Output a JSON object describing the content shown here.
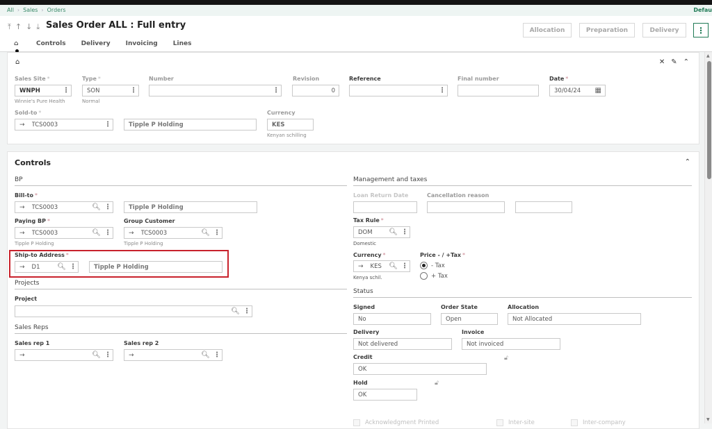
{
  "breadcrumb": [
    "All",
    "Sales",
    "Orders"
  ],
  "breadcrumb_right": "Defau",
  "header": {
    "nav_icons": [
      "first-record-icon",
      "previous-record-icon",
      "next-record-icon",
      "last-record-icon"
    ],
    "nav_glyphs": [
      "⤒",
      "↑",
      "↓",
      "⤓"
    ],
    "title": "Sales Order ALL : Full entry",
    "buttons": [
      "Allocation",
      "Preparation",
      "Delivery"
    ],
    "more_glyph": "⋮"
  },
  "tabs": [
    "Controls",
    "Delivery",
    "Invoicing",
    "Lines"
  ],
  "home_glyph": "⌂",
  "header_card": {
    "tools": {
      "pin": "✕",
      "edit": "✎",
      "collapse": "⌃"
    },
    "sales_site": {
      "label": "Sales Site",
      "value": "WNPH",
      "sub": "Winnie's Pure Health"
    },
    "type": {
      "label": "Type",
      "value": "SON",
      "sub": "Normal"
    },
    "number": {
      "label": "Number",
      "value": ""
    },
    "revision": {
      "label": "Revision",
      "value": "0"
    },
    "reference": {
      "label": "Reference",
      "value": ""
    },
    "final_number": {
      "label": "Final number",
      "value": ""
    },
    "date": {
      "label": "Date",
      "value": "30/04/24"
    },
    "sold_to": {
      "label": "Sold-to",
      "value": "TCS0003",
      "name": "Tipple P Holding"
    },
    "currency": {
      "label": "Currency",
      "value": "KES",
      "sub": "Kenyan schilling"
    }
  },
  "controls": {
    "title": "Controls",
    "bp_group": "BP",
    "bill_to": {
      "label": "Bill-to",
      "value": "TCS0003",
      "name": "Tipple P Holding"
    },
    "paying_bp": {
      "label": "Paying BP",
      "value": "TCS0003",
      "sub": "Tipple P Holding"
    },
    "group_customer": {
      "label": "Group Customer",
      "value": "TCS0003",
      "sub": "Tipple P Holding"
    },
    "ship_to": {
      "label": "Ship-to Address",
      "value": "D1",
      "name": "Tipple P Holding"
    },
    "projects_group": "Projects",
    "project": {
      "label": "Project",
      "value": ""
    },
    "sales_reps_group": "Sales Reps",
    "sales_rep1": {
      "label": "Sales rep 1",
      "value": ""
    },
    "sales_rep2": {
      "label": "Sales rep 2",
      "value": ""
    },
    "mgmt_group": "Management and taxes",
    "loan_return_date": {
      "label": "Loan Return Date",
      "value": ""
    },
    "cancellation_reason": {
      "label": "Cancellation reason",
      "value": "",
      "value2": ""
    },
    "tax_rule": {
      "label": "Tax Rule",
      "value": "DOM",
      "sub": "Domestic"
    },
    "currency": {
      "label": "Currency",
      "value": "KES",
      "sub": "Kenya schil."
    },
    "price_tax": {
      "label": "Price - / +Tax",
      "options": [
        "- Tax",
        "+ Tax"
      ],
      "selected": "- Tax"
    },
    "status_group": "Status",
    "signed": {
      "label": "Signed",
      "value": "No"
    },
    "order_state": {
      "label": "Order State",
      "value": "Open"
    },
    "allocation": {
      "label": "Allocation",
      "value": "Not Allocated"
    },
    "delivery": {
      "label": "Delivery",
      "value": "Not delivered"
    },
    "invoice": {
      "label": "Invoice",
      "value": "Not invoiced"
    },
    "credit": {
      "label": "Credit",
      "value": "OK"
    },
    "hold": {
      "label": "Hold",
      "value": "OK"
    },
    "checkboxes": [
      "Acknowledgment Printed",
      "Inter-site",
      "Inter-company"
    ]
  },
  "icons": {
    "arrow": "→",
    "search": "🔍︎",
    "dots": "⋮",
    "calendar": "▦",
    "lock": "🔓︎"
  }
}
